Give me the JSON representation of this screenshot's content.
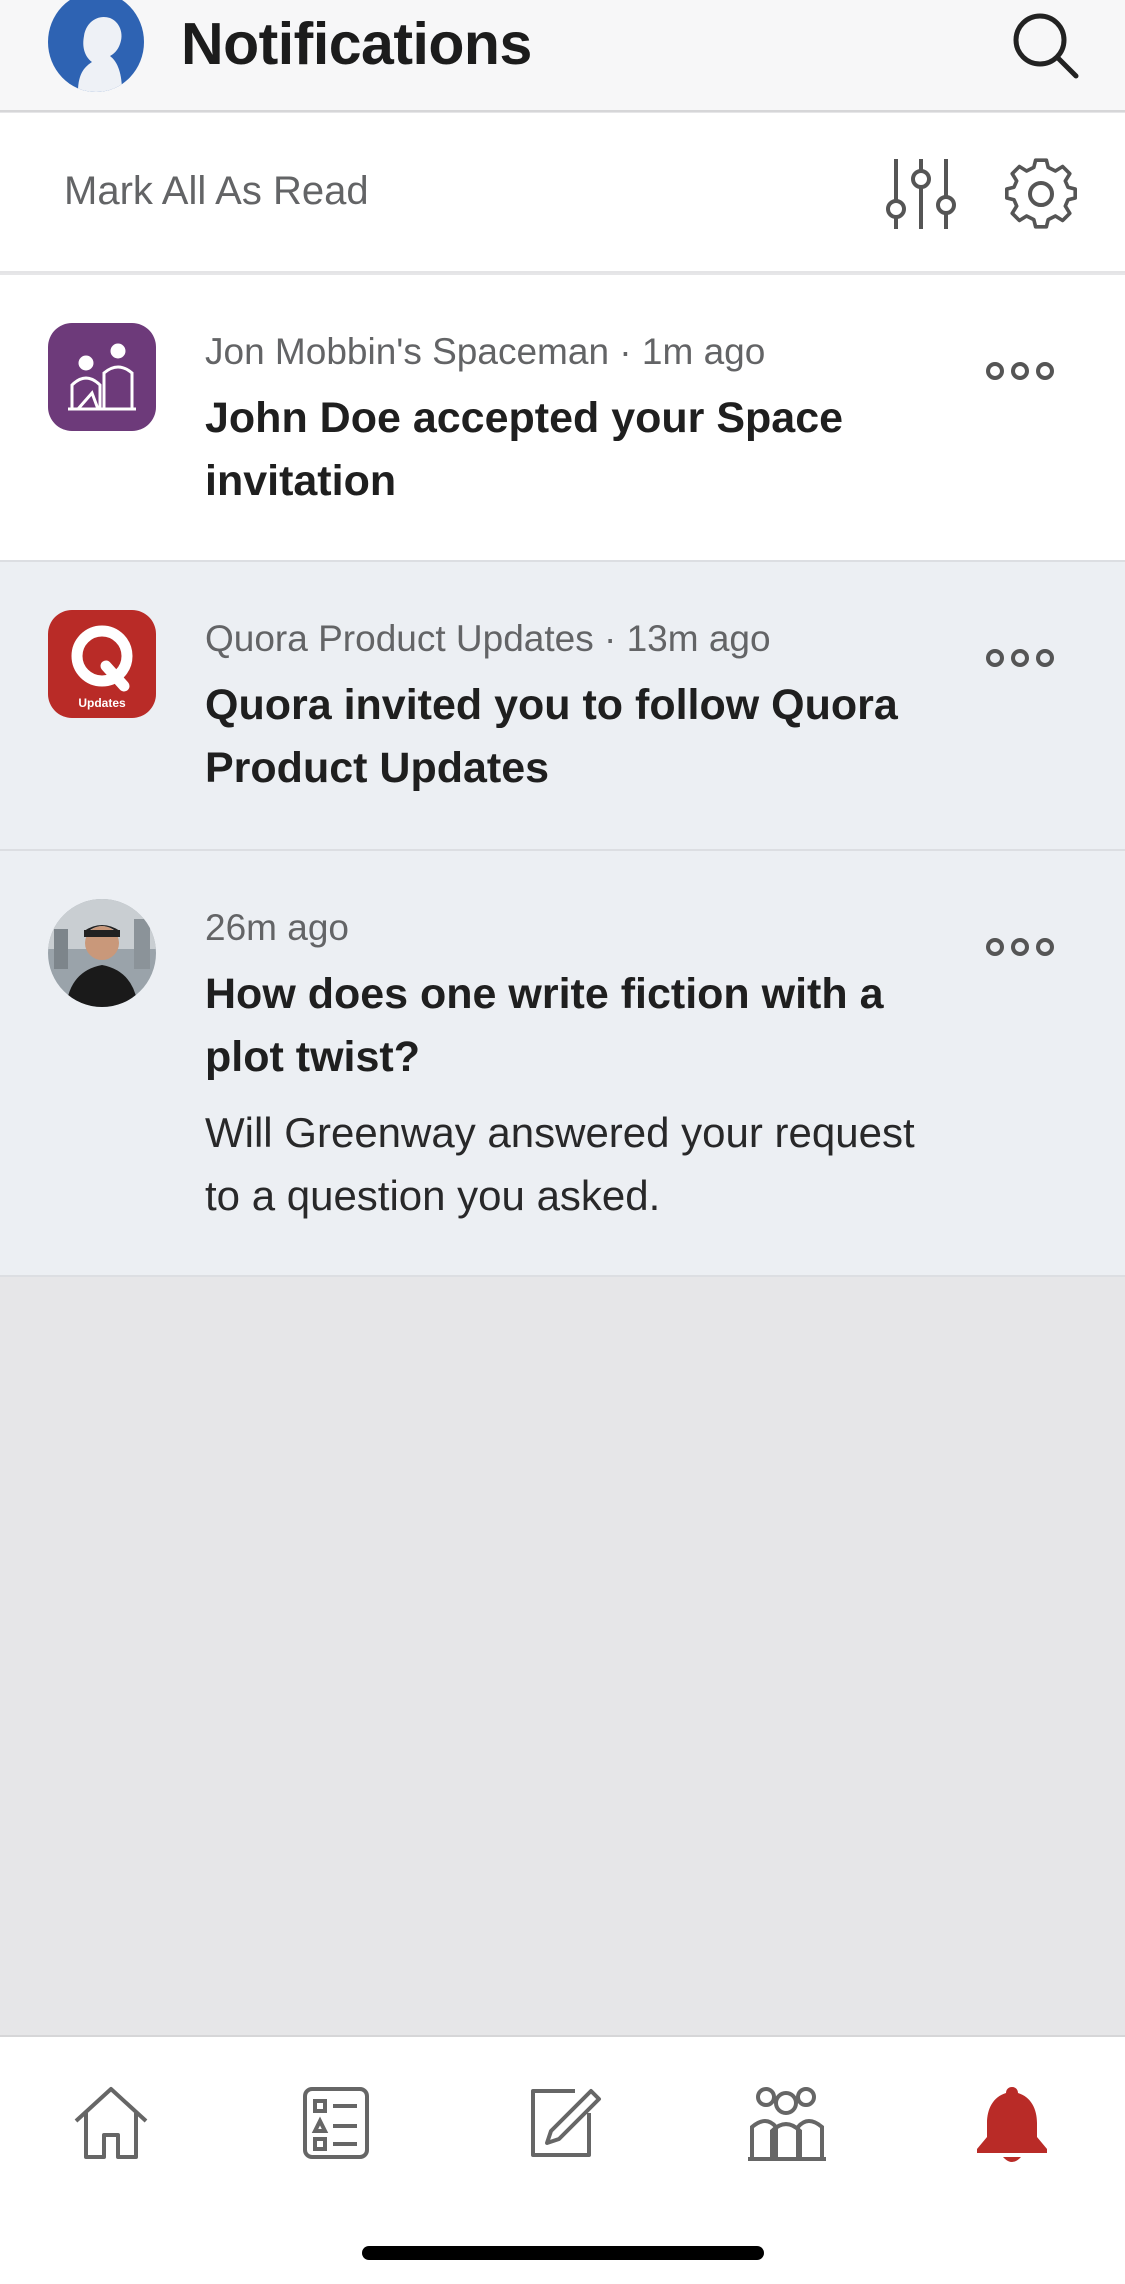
{
  "header": {
    "title": "Notifications"
  },
  "toolbar": {
    "mark_all_label": "Mark All As Read"
  },
  "notifications": [
    {
      "source": "Jon Mobbin's Spaceman · 1m ago",
      "title": "John Doe accepted your Space invitation",
      "state": "read",
      "icon": "space-icon"
    },
    {
      "source": "Quora Product Updates · 13m ago",
      "title": "Quora invited you to follow Quora Product Updates",
      "state": "unread",
      "icon": "quora-updates-logo",
      "icon_label": "Updates"
    },
    {
      "source": "26m ago",
      "title": "How does one write fiction with a plot twist?",
      "body": "Will Greenway answered your request to a question you asked.",
      "state": "unread",
      "icon": "user-avatar"
    }
  ],
  "tabs": [
    {
      "name": "home",
      "icon": "home-icon",
      "active": false
    },
    {
      "name": "following",
      "icon": "list-icon",
      "active": false
    },
    {
      "name": "write",
      "icon": "pencil-icon",
      "active": false
    },
    {
      "name": "spaces",
      "icon": "people-icon",
      "active": false
    },
    {
      "name": "notifications",
      "icon": "bell-icon",
      "active": true
    }
  ],
  "colors": {
    "brand_red": "#b92b27",
    "space_purple": "#6d3a7a",
    "profile_blue": "#2e63b3",
    "unread_bg": "#eceff3",
    "page_bg": "#e6e6e8"
  }
}
